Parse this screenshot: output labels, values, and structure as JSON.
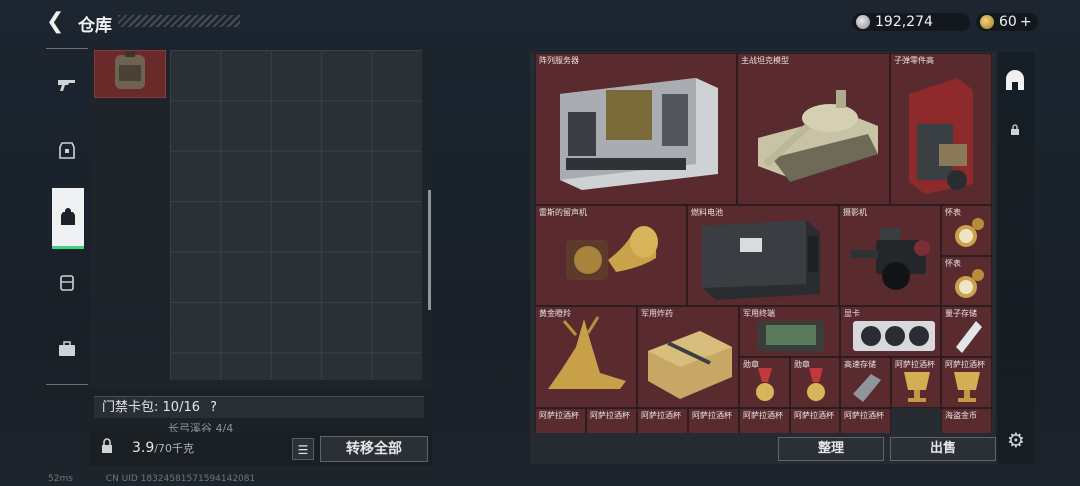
{
  "header": {
    "title": "仓库",
    "currency_1": "192,274",
    "currency_2": "60",
    "plus": "+"
  },
  "nav": {
    "items": [
      "weapon-icon",
      "armor-icon",
      "backpack-icon",
      "rig-icon",
      "case-icon"
    ]
  },
  "left": {
    "keycard_label": "门禁卡包:",
    "keycard_value": "10/16",
    "keycard_help": "?",
    "sub_label": "长弓溪谷  4/4",
    "weight_value": "3.9",
    "weight_cap": "/70千克",
    "transfer_all": "转移全部"
  },
  "items": [
    {
      "name": "阵列服务器",
      "color": "#5a2b2e"
    },
    {
      "name": "主战坦克模型",
      "color": "#5a2b2e"
    },
    {
      "name": "子弹零件高",
      "color": "#5a2b2e"
    },
    {
      "name": "雷斯的留声机",
      "color": "#5a2b2e"
    },
    {
      "name": "燃料电池",
      "color": "#5a2b2e"
    },
    {
      "name": "摄影机",
      "color": "#5a2b2e"
    },
    {
      "name": "怀表",
      "color": "#5a2b2e"
    },
    {
      "name": "怀表",
      "color": "#5a2b2e"
    },
    {
      "name": "黄金瞪羚",
      "color": "#5a2b2e"
    },
    {
      "name": "军用炸药",
      "color": "#5a2b2e"
    },
    {
      "name": "军用终端",
      "color": "#5a2b2e"
    },
    {
      "name": "显卡",
      "color": "#5a2b2e"
    },
    {
      "name": "量子存储",
      "color": "#5a2b2e"
    },
    {
      "name": "勋章",
      "color": "#5a2b2e"
    },
    {
      "name": "勋章",
      "color": "#5a2b2e"
    },
    {
      "name": "高速存储",
      "color": "#5a2b2e"
    },
    {
      "name": "阿萨拉酒杯",
      "color": "#5a2b2e"
    },
    {
      "name": "阿萨拉酒杯",
      "color": "#5a2b2e"
    },
    {
      "name": "阿萨拉酒杯",
      "color": "#5a2b2e"
    },
    {
      "name": "阿萨拉酒杯",
      "color": "#5a2b2e"
    },
    {
      "name": "阿萨拉酒杯",
      "color": "#5a2b2e"
    },
    {
      "name": "阿萨拉酒杯",
      "color": "#5a2b2e"
    },
    {
      "name": "阿萨拉酒杯",
      "color": "#5a2b2e"
    },
    {
      "name": "阿萨拉酒杯",
      "color": "#5a2b2e"
    },
    {
      "name": "阿萨拉酒杯",
      "color": "#5a2b2e"
    },
    {
      "name": "海盗金币",
      "color": "#5a2b2e"
    }
  ],
  "actions": {
    "sort": "整理",
    "sell": "出售"
  },
  "status": {
    "ping": "52ms",
    "uid": "CN UID 18324581571594142081"
  }
}
